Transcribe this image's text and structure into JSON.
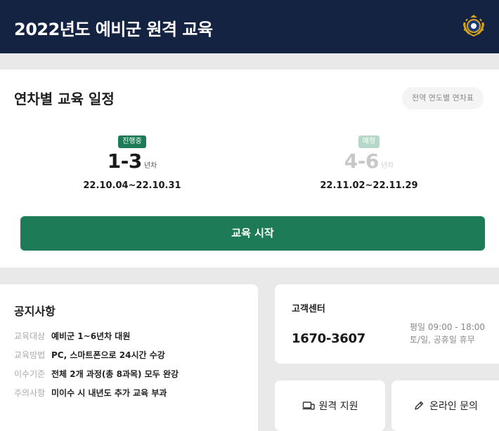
{
  "header": {
    "title": "2022년도 예비군 원격 교육",
    "emblem_icon": "reserve-forces-emblem-icon"
  },
  "schedule": {
    "title": "연차별 교육 일정",
    "chart_link_label": "전역 연도별 연차표",
    "periods": [
      {
        "status": "진행중",
        "range": "1-3",
        "unit": "년차",
        "dates": "22.10.04~22.10.31"
      },
      {
        "status": "예정",
        "range": "4-6",
        "unit": "년차",
        "dates": "22.11.02~22.11.29"
      }
    ],
    "start_button_label": "교육 시작"
  },
  "notice": {
    "title": "공지사항",
    "items": [
      {
        "key": "교육대상",
        "value": "예비군 1~6년차 대원"
      },
      {
        "key": "교육방법",
        "value": "PC, 스마트폰으로 24시간 수강"
      },
      {
        "key": "이수기준",
        "value": "전체 2개 과정(총 8과목) 모두 완강"
      },
      {
        "key": "주의사항",
        "value": "미이수 시 내년도 추가 교육 부과"
      }
    ]
  },
  "support": {
    "title": "고객센터",
    "phone": "1670-3607",
    "hours_weekday": "평일 09:00 - 18:00",
    "hours_weekend": "토/일, 공휴일 휴무"
  },
  "actions": {
    "remote_support_label": "원격 지원",
    "online_inquiry_label": "온라인 문의"
  },
  "colors": {
    "header_bg": "#142341",
    "primary_green": "#1d7c57",
    "upcoming_badge": "#b6d8c9",
    "page_bg": "#e9e9e9"
  }
}
